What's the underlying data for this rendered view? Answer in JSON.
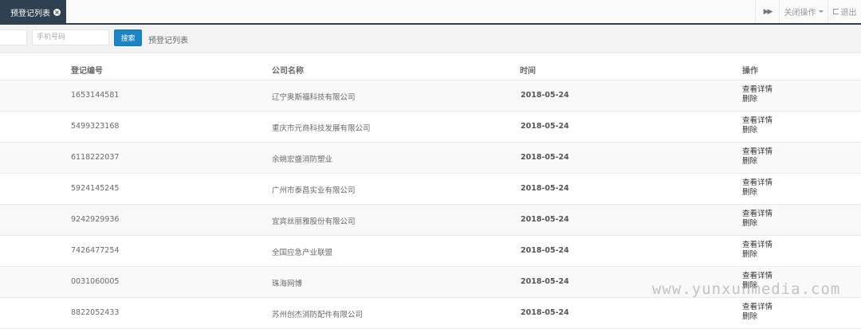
{
  "tabs": {
    "active_label": "预登记列表",
    "close_icon": "close-circle-icon",
    "forward_icon": "double-chevron-right-icon",
    "close_ops_label": "关闭操作",
    "logout_label": "退出",
    "logout_icon": "sign-out-icon"
  },
  "search": {
    "first_input_placeholder": "",
    "phone_placeholder": "手机号码",
    "button_label": "搜索",
    "label": "预登记列表"
  },
  "table": {
    "headers": {
      "code": "登记编号",
      "company": "公司名称",
      "date": "时间",
      "ops": "操作"
    },
    "rows": [
      {
        "code": "1653144581",
        "company": "辽宁奥斯福科技有限公司",
        "date": "2018-05-24",
        "view": "查看详情",
        "delete": "删除"
      },
      {
        "code": "5499323168",
        "company": "重庆市元商科技发展有限公司",
        "date": "2018-05-24",
        "view": "查看详情",
        "delete": "删除"
      },
      {
        "code": "6118222037",
        "company": "余姚宏盛消防塑业",
        "date": "2018-05-24",
        "view": "查看详情",
        "delete": "删除"
      },
      {
        "code": "5924145245",
        "company": "广州市泰昌实业有限公司",
        "date": "2018-05-24",
        "view": "查看详情",
        "delete": "删除"
      },
      {
        "code": "9242929936",
        "company": "宜宾丝丽雅股份有限公司",
        "date": "2018-05-24",
        "view": "查看详情",
        "delete": "删除"
      },
      {
        "code": "7426477254",
        "company": "全国应急产业联盟",
        "date": "2018-05-24",
        "view": "查看详情",
        "delete": "删除"
      },
      {
        "code": "0031060005",
        "company": "珠海网博",
        "date": "2018-05-24",
        "view": "查看详情",
        "delete": "删除"
      },
      {
        "code": "8822052433",
        "company": "苏州创杰消防配件有限公司",
        "date": "2018-05-24",
        "view": "查看详情",
        "delete": "删除"
      }
    ]
  },
  "watermark": "www.yunxunmedia.com",
  "colors": {
    "nav_dark": "#2f4050",
    "primary_button": "#1c84c6",
    "stripe": "#f9f9f9"
  }
}
